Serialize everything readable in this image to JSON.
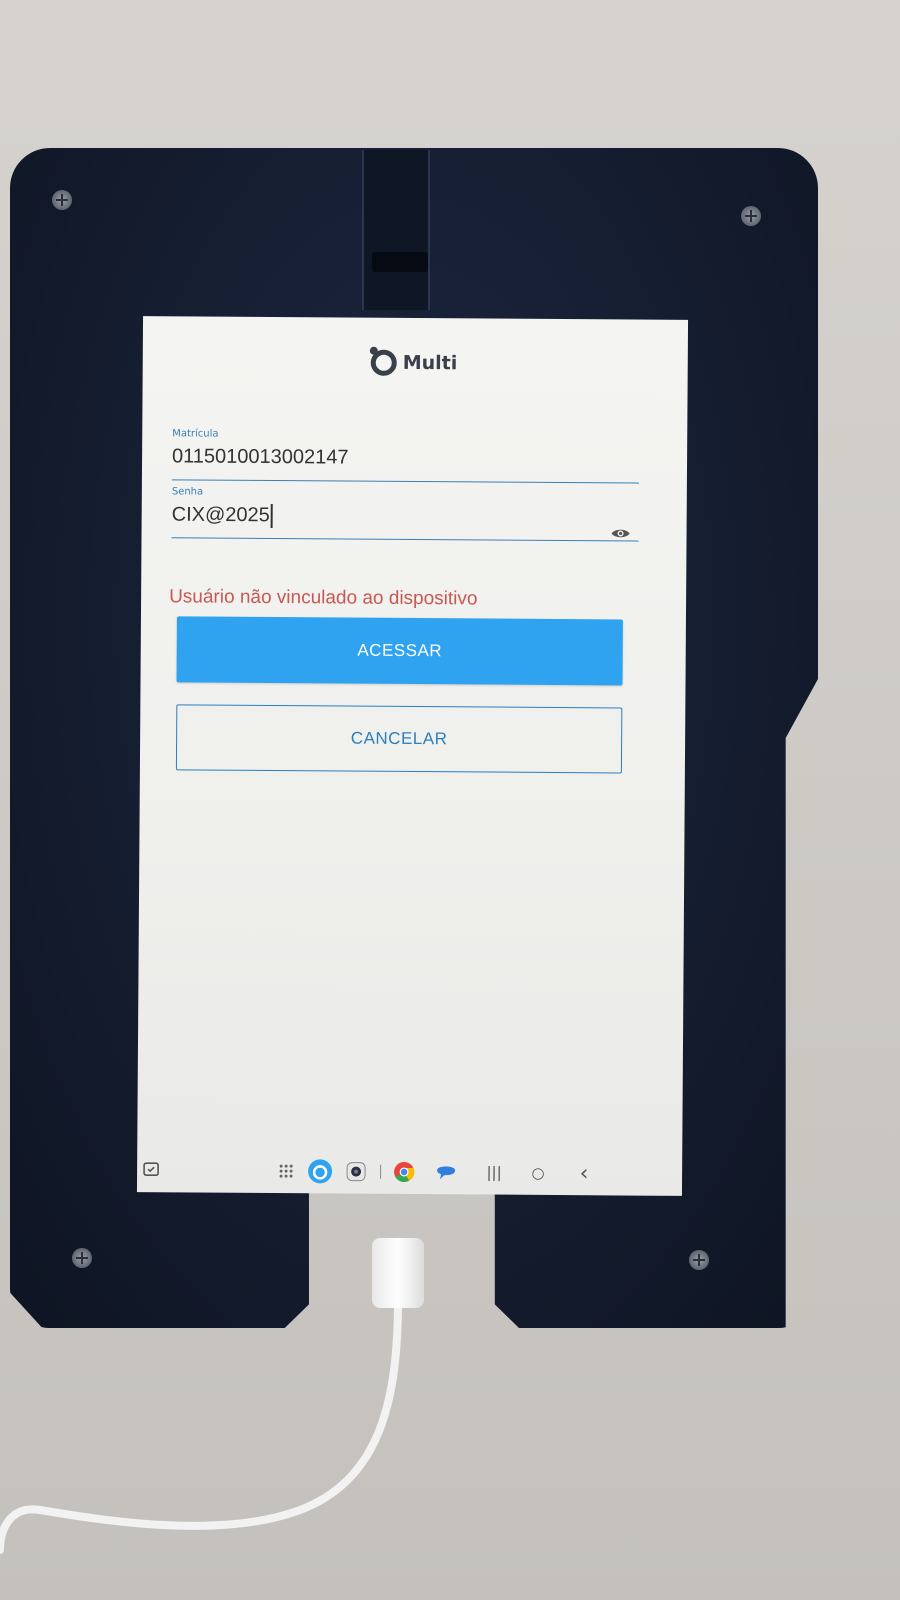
{
  "app": {
    "logo_text": "Multi"
  },
  "form": {
    "matricula_label": "Matrícula",
    "matricula_value": "0115010013002147",
    "senha_label": "Senha",
    "senha_value": "CIX@2025"
  },
  "error": {
    "message": "Usuário não vinculado ao dispositivo"
  },
  "buttons": {
    "acessar_label": "ACESSAR",
    "cancelar_label": "CANCELAR"
  },
  "nav_bar": {
    "icons": [
      "apps-grid-icon",
      "multi-app-icon",
      "camera-app-icon",
      "chrome-icon",
      "messages-icon",
      "recents-icon",
      "home-icon",
      "back-icon"
    ],
    "recents_glyph": "|||",
    "home_glyph": "○",
    "back_glyph": "‹"
  },
  "colors": {
    "accent": "#2fa2f0",
    "accent_dark": "#2c7fbf",
    "error": "#c65a52",
    "label": "#3a7fb5",
    "frame": "#151d30"
  }
}
